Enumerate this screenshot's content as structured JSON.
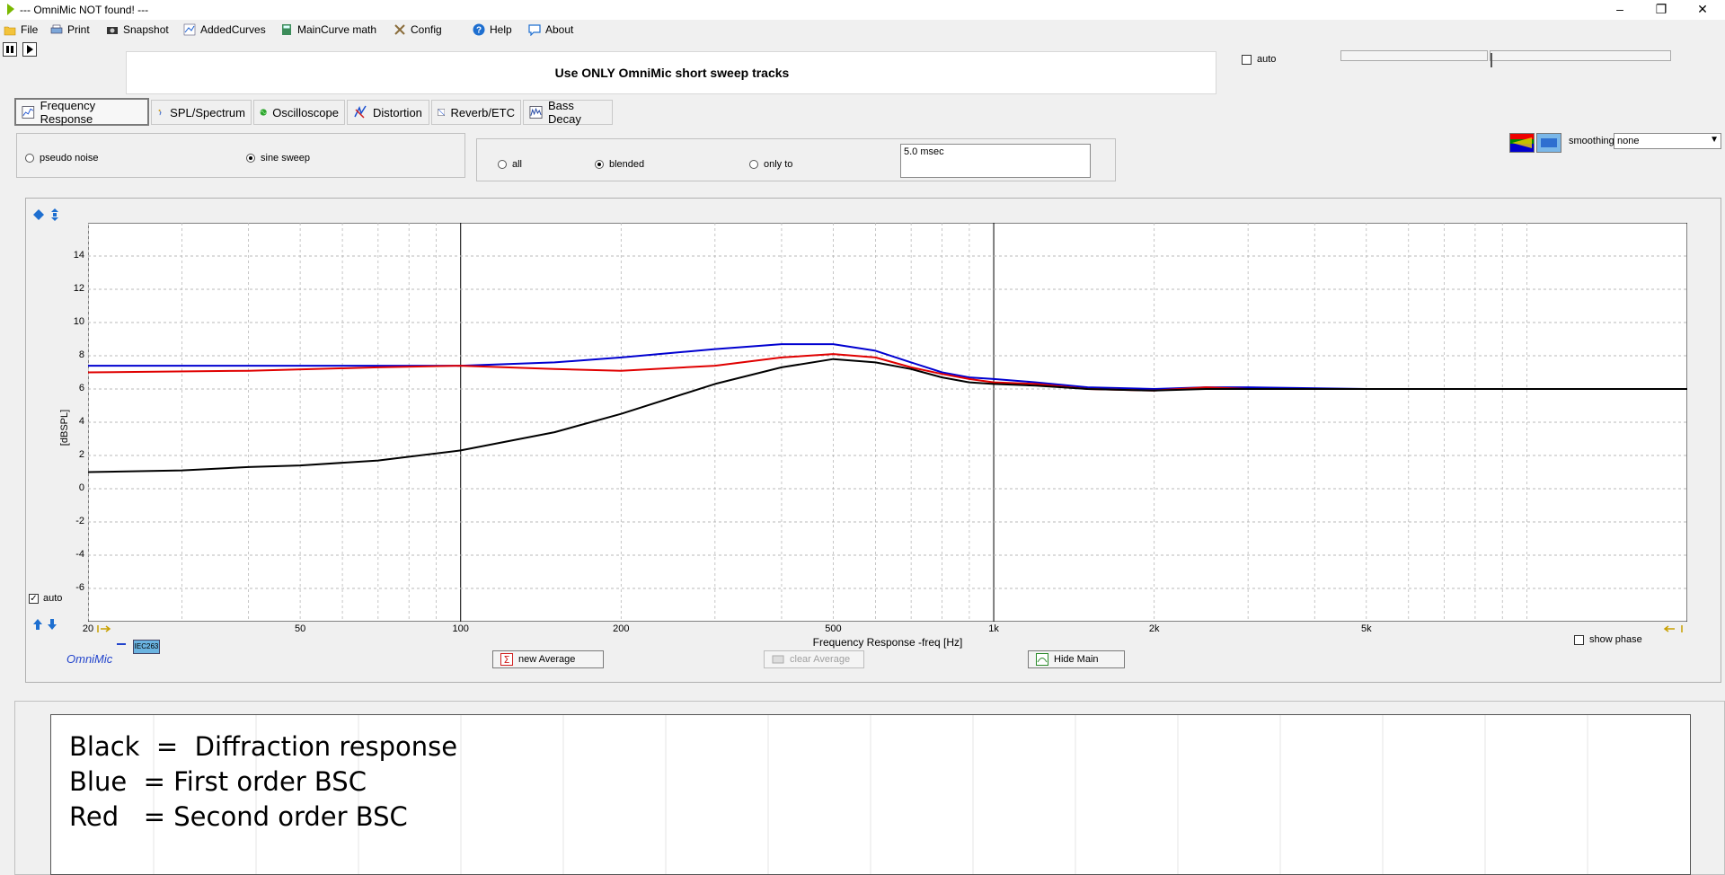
{
  "window": {
    "title": "--- OmniMic NOT found! ---"
  },
  "menu": [
    {
      "label": "File",
      "icon": "folder-icon"
    },
    {
      "label": "Print",
      "icon": "printer-icon"
    },
    {
      "label": "Snapshot",
      "icon": "camera-icon"
    },
    {
      "label": "AddedCurves",
      "icon": "curves-icon"
    },
    {
      "label": "MainCurve math",
      "icon": "calculator-icon"
    },
    {
      "label": "Config",
      "icon": "tools-icon"
    },
    {
      "label": "Help",
      "icon": "help-icon"
    },
    {
      "label": "About",
      "icon": "speech-bubble-icon"
    }
  ],
  "banner": {
    "text": "Use ONLY OmniMic short sweep tracks"
  },
  "top_right": {
    "auto_label": "auto"
  },
  "tabs": [
    {
      "label": "Frequency Response",
      "active": true
    },
    {
      "label": "SPL/Spectrum"
    },
    {
      "label": "Oscilloscope"
    },
    {
      "label": "Distortion"
    },
    {
      "label": "Reverb/ETC"
    },
    {
      "label": "Bass Decay"
    }
  ],
  "signal": {
    "pseudo_noise": "pseudo noise",
    "sine_sweep": "sine sweep",
    "selected": "sine sweep"
  },
  "gating": {
    "all": "all",
    "blended": "blended",
    "only_to": "only to",
    "selected": "blended",
    "time_value": "5.0 msec"
  },
  "smoothing": {
    "label": "smoothing",
    "value": "none"
  },
  "graph": {
    "auto_label": "auto",
    "omnimic_label": "OmniMic",
    "cal_label": "IEC263",
    "show_phase_label": "show phase",
    "new_average": "new Average",
    "clear_average": "clear Average",
    "hide_main": "Hide Main"
  },
  "chart_data": {
    "type": "line",
    "xscale": "log",
    "xlim": [
      20,
      20000
    ],
    "ylim": [
      -8,
      16
    ],
    "xlabel": "Frequency Response -freq [Hz]",
    "ylabel": "[dBSPL]",
    "x_tick_labels": [
      {
        "x": 20,
        "label": "20"
      },
      {
        "x": 50,
        "label": "50"
      },
      {
        "x": 100,
        "label": "100"
      },
      {
        "x": 200,
        "label": "200"
      },
      {
        "x": 500,
        "label": "500"
      },
      {
        "x": 1000,
        "label": "1k"
      },
      {
        "x": 2000,
        "label": "2k"
      },
      {
        "x": 5000,
        "label": "5k"
      }
    ],
    "y_ticks": [
      14,
      12,
      10,
      8,
      6,
      4,
      2,
      0,
      -2,
      -4,
      -6
    ],
    "grid": true,
    "series": [
      {
        "color": "#0000d0",
        "points": [
          [
            20,
            7.4
          ],
          [
            50,
            7.4
          ],
          [
            100,
            7.4
          ],
          [
            150,
            7.6
          ],
          [
            200,
            7.9
          ],
          [
            300,
            8.4
          ],
          [
            400,
            8.7
          ],
          [
            500,
            8.7
          ],
          [
            600,
            8.3
          ],
          [
            700,
            7.6
          ],
          [
            800,
            7.0
          ],
          [
            900,
            6.7
          ],
          [
            1000,
            6.6
          ],
          [
            1200,
            6.4
          ],
          [
            1500,
            6.1
          ],
          [
            2000,
            6.0
          ],
          [
            2500,
            6.1
          ],
          [
            3000,
            6.1
          ],
          [
            5000,
            6.0
          ],
          [
            10000,
            6.0
          ],
          [
            20000,
            6.0
          ]
        ]
      },
      {
        "color": "#e00000",
        "points": [
          [
            20,
            7.0
          ],
          [
            40,
            7.1
          ],
          [
            70,
            7.3
          ],
          [
            100,
            7.4
          ],
          [
            150,
            7.2
          ],
          [
            200,
            7.1
          ],
          [
            300,
            7.4
          ],
          [
            400,
            7.9
          ],
          [
            500,
            8.1
          ],
          [
            600,
            7.9
          ],
          [
            700,
            7.3
          ],
          [
            800,
            6.9
          ],
          [
            900,
            6.6
          ],
          [
            1000,
            6.4
          ],
          [
            1200,
            6.3
          ],
          [
            1500,
            6.0
          ],
          [
            2000,
            5.9
          ],
          [
            2500,
            6.1
          ],
          [
            3000,
            6.0
          ],
          [
            5000,
            6.0
          ],
          [
            10000,
            6.0
          ],
          [
            20000,
            6.0
          ]
        ]
      },
      {
        "color": "#000000",
        "points": [
          [
            20,
            1.0
          ],
          [
            30,
            1.1
          ],
          [
            40,
            1.3
          ],
          [
            50,
            1.4
          ],
          [
            70,
            1.7
          ],
          [
            100,
            2.3
          ],
          [
            150,
            3.4
          ],
          [
            200,
            4.5
          ],
          [
            300,
            6.3
          ],
          [
            400,
            7.3
          ],
          [
            500,
            7.8
          ],
          [
            600,
            7.6
          ],
          [
            700,
            7.2
          ],
          [
            800,
            6.7
          ],
          [
            900,
            6.4
          ],
          [
            1000,
            6.3
          ],
          [
            1200,
            6.2
          ],
          [
            1500,
            6.0
          ],
          [
            2000,
            5.9
          ],
          [
            2500,
            6.0
          ],
          [
            3000,
            6.0
          ],
          [
            5000,
            6.0
          ],
          [
            10000,
            6.0
          ],
          [
            20000,
            6.0
          ]
        ]
      }
    ]
  },
  "notes": {
    "line1": "Black  =  Diffraction response",
    "line2": "Blue  = First order BSC",
    "line3": "Red   = Second order BSC"
  }
}
